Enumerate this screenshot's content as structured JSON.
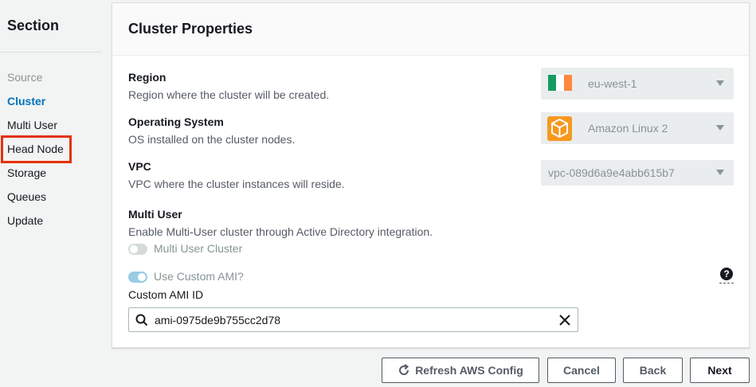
{
  "sidebar": {
    "title": "Section",
    "items": [
      {
        "label": "Source",
        "state": "disabled"
      },
      {
        "label": "Cluster",
        "state": "active"
      },
      {
        "label": "Multi User",
        "state": "normal"
      },
      {
        "label": "Head Node",
        "state": "highlighted"
      },
      {
        "label": "Storage",
        "state": "normal"
      },
      {
        "label": "Queues",
        "state": "normal"
      },
      {
        "label": "Update",
        "state": "normal"
      }
    ]
  },
  "panel": {
    "title": "Cluster Properties",
    "region": {
      "label": "Region",
      "description": "Region where the cluster will be created.",
      "value": "eu-west-1",
      "icon": "ireland-flag-icon"
    },
    "os": {
      "label": "Operating System",
      "description": "OS installed on the cluster nodes.",
      "value": "Amazon Linux 2",
      "icon": "box-icon"
    },
    "vpc": {
      "label": "VPC",
      "description": "VPC where the cluster instances will reside.",
      "value": "vpc-089d6a9e4abb615b7"
    },
    "multi_user": {
      "label": "Multi User",
      "description": "Enable Multi-User cluster through Active Directory integration.",
      "toggle_label": "Multi User Cluster",
      "toggle_on": false
    },
    "custom_ami": {
      "toggle_label": "Use Custom AMI?",
      "toggle_on": true,
      "field_label": "Custom AMI ID",
      "value": "ami-0975de9b755cc2d78",
      "help_icon": "?"
    }
  },
  "footer": {
    "refresh_label": "Refresh AWS Config",
    "cancel_label": "Cancel",
    "back_label": "Back",
    "next_label": "Next"
  },
  "colors": {
    "accent": "#0073bb",
    "highlight": "#e5300c",
    "toggle_on": "#99cbe4",
    "toggle_off": "#d5dbdb",
    "flag_green": "#169b62",
    "flag_white": "#ffffff",
    "flag_orange": "#ff883e"
  }
}
